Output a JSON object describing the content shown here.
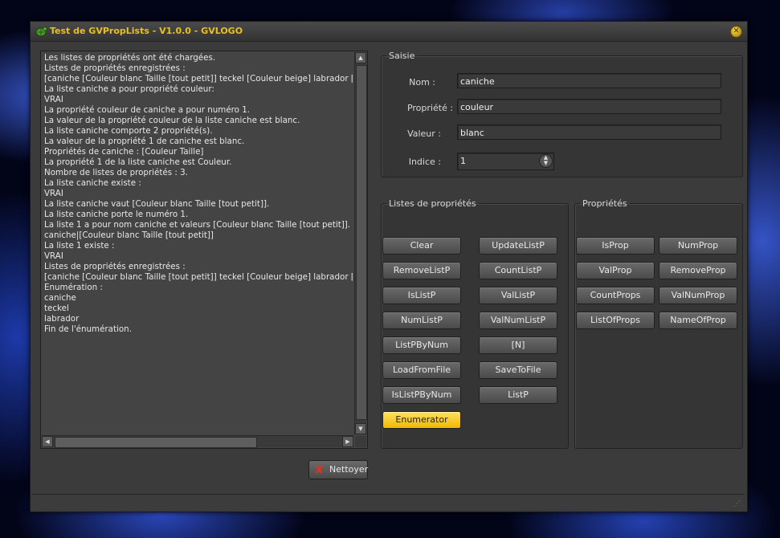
{
  "window": {
    "title": "Test de GVPropLists - V1.0.0 - GVLOGO",
    "close_icon": "close-icon"
  },
  "log": {
    "text": "Les listes de propriétés ont été chargées.\nListes de propriétés enregistrées :\n[caniche [Couleur blanc Taille [tout petit]] teckel [Couleur beige] labrador [Coule\nLa liste caniche a pour propriété couleur:\nVRAI\nLa propriété couleur de caniche a pour numéro 1.\nLa valeur de la propriété couleur de la liste caniche est blanc.\nLa liste caniche comporte 2 propriété(s).\nLa valeur de la propriété 1 de caniche est blanc.\nPropriétés de caniche : [Couleur Taille]\nLa propriété 1 de la liste caniche est Couleur.\nNombre de listes de propriétés : 3.\nLa liste caniche existe :\nVRAI\nLa liste caniche vaut [Couleur blanc Taille [tout petit]].\nLa liste caniche porte le numéro 1.\nLa liste 1 a pour nom caniche et valeurs [Couleur blanc Taille [tout petit]].\ncaniche|[Couleur blanc Taille [tout petit]]\nLa liste 1 existe :\nVRAI\nListes de propriétés enregistrées :\n[caniche [Couleur blanc Taille [tout petit]] teckel [Couleur beige] labrador [Coule\nEnumération :\ncaniche\nteckel\nlabrador\nFin de l'énumération."
  },
  "saisie": {
    "legend": "Saisie",
    "nom_label": "Nom :",
    "nom_value": "caniche",
    "propriete_label": "Propriété :",
    "propriete_value": "couleur",
    "valeur_label": "Valeur :",
    "valeur_value": "blanc",
    "indice_label": "Indice :",
    "indice_value": "1"
  },
  "listes": {
    "legend": "Listes de propriétés",
    "buttons": [
      "Clear",
      "UpdateListP",
      "RemoveListP",
      "CountListP",
      "IsListP",
      "ValListP",
      "NumListP",
      "ValNumListP",
      "ListPByNum",
      "[N]",
      "LoadFromFile",
      "SaveToFile",
      "IsListPByNum",
      "ListP",
      "Enumerator"
    ]
  },
  "proprietes": {
    "legend": "Propriétés",
    "buttons": [
      "IsProp",
      "NumProp",
      "ValProp",
      "RemoveProp",
      "CountProps",
      "ValNumProp",
      "ListOfProps",
      "NameOfProp"
    ]
  },
  "nettoyer_label": "Nettoyer",
  "colors": {
    "title": "#e8c020",
    "active_button": "#f8c820",
    "nettoyer_icon": "#e03020"
  }
}
